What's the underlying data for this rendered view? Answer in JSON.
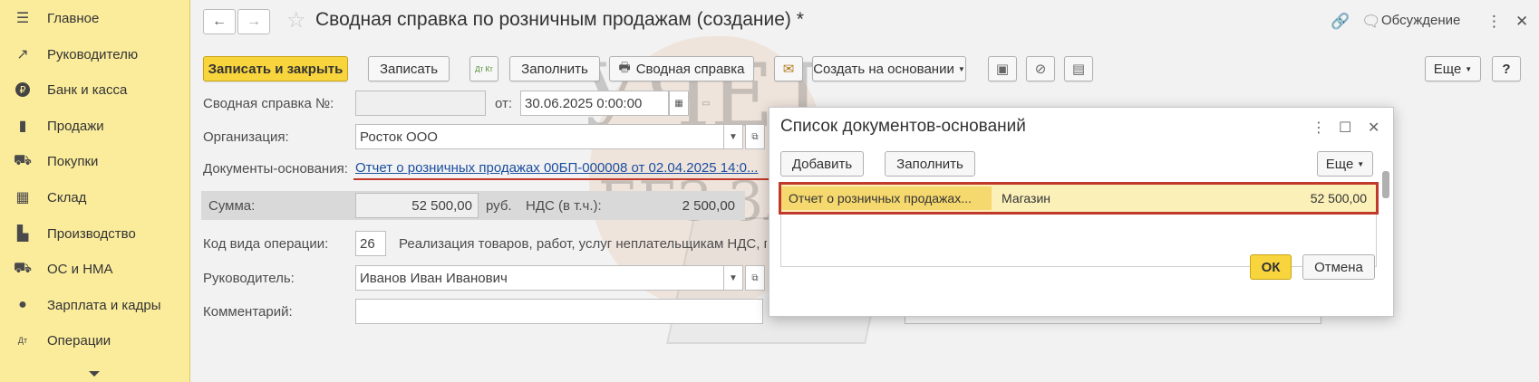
{
  "sidebar": {
    "items": [
      {
        "icon": "menu-icon",
        "glyph": "☰",
        "label": "Главное"
      },
      {
        "icon": "trend-icon",
        "glyph": "↗",
        "label": "Руководителю"
      },
      {
        "icon": "coin-icon",
        "glyph": "₽",
        "label": "Банк и касса"
      },
      {
        "icon": "bag-icon",
        "glyph": "▮",
        "label": "Продажи"
      },
      {
        "icon": "cart-icon",
        "glyph": "⛟",
        "label": "Покупки"
      },
      {
        "icon": "warehouse-icon",
        "glyph": "▦",
        "label": "Склад"
      },
      {
        "icon": "factory-icon",
        "glyph": "▙",
        "label": "Производство"
      },
      {
        "icon": "truck-icon",
        "glyph": "⛟",
        "label": "ОС и НМА"
      },
      {
        "icon": "person-icon",
        "glyph": "●",
        "label": "Зарплата и кадры"
      },
      {
        "icon": "dt-kt-icon",
        "glyph": "Дт",
        "label": "Операции"
      }
    ]
  },
  "header": {
    "back": "←",
    "forward": "→",
    "star": "☆",
    "title": "Сводная справка по розничным продажам (создание) *",
    "link_icon": "🔗",
    "discuss_icon": "🗨",
    "discuss": "Обсуждение",
    "more_icon": "⋮",
    "close_icon": "✕"
  },
  "toolbar": {
    "save_close": "Записать и закрыть",
    "save": "Записать",
    "dtkt": "Дт Кт",
    "fill": "Заполнить",
    "print_glyph": "🖶",
    "summary": "Сводная справка",
    "mail_glyph": "✉",
    "create_basis": "Создать на основании",
    "more": "Еще",
    "help": "?"
  },
  "form": {
    "number_label": "Сводная справка №:",
    "number_value": "",
    "date_label": "от:",
    "date_value": "30.06.2025  0:00:00",
    "org_label": "Организация:",
    "org_value": "Росток ООО",
    "docs_label": "Документы-основания:",
    "docs_link": "Отчет о розничных продажах 00БП-000008 от 02.04.2025 14:0...",
    "sum_label": "Сумма:",
    "sum_value": "52 500,00",
    "currency": "руб.",
    "vat_label": "НДС (в т.ч.):",
    "vat_value": "2 500,00",
    "op_label": "Код вида операции:",
    "op_code": "26",
    "op_text": "Реализация товаров, работ, услуг неплательщикам НДС, по",
    "head_label": "Руководитель:",
    "head_value": "Иванов Иван Иванович",
    "comment_label": "Комментарий:",
    "comment_value": ""
  },
  "watermark": {
    "line1": "УЧЕТ",
    "line2": "БЕЗ ЗАБОТ"
  },
  "dialog": {
    "title": "Список документов-оснований",
    "add": "Добавить",
    "fill": "Заполнить",
    "more": "Еще",
    "rows": [
      {
        "doc": "Отчет о розничных продажах...",
        "store": "Магазин",
        "sum": "52 500,00"
      }
    ],
    "ok": "ОК",
    "cancel": "Отмена"
  }
}
